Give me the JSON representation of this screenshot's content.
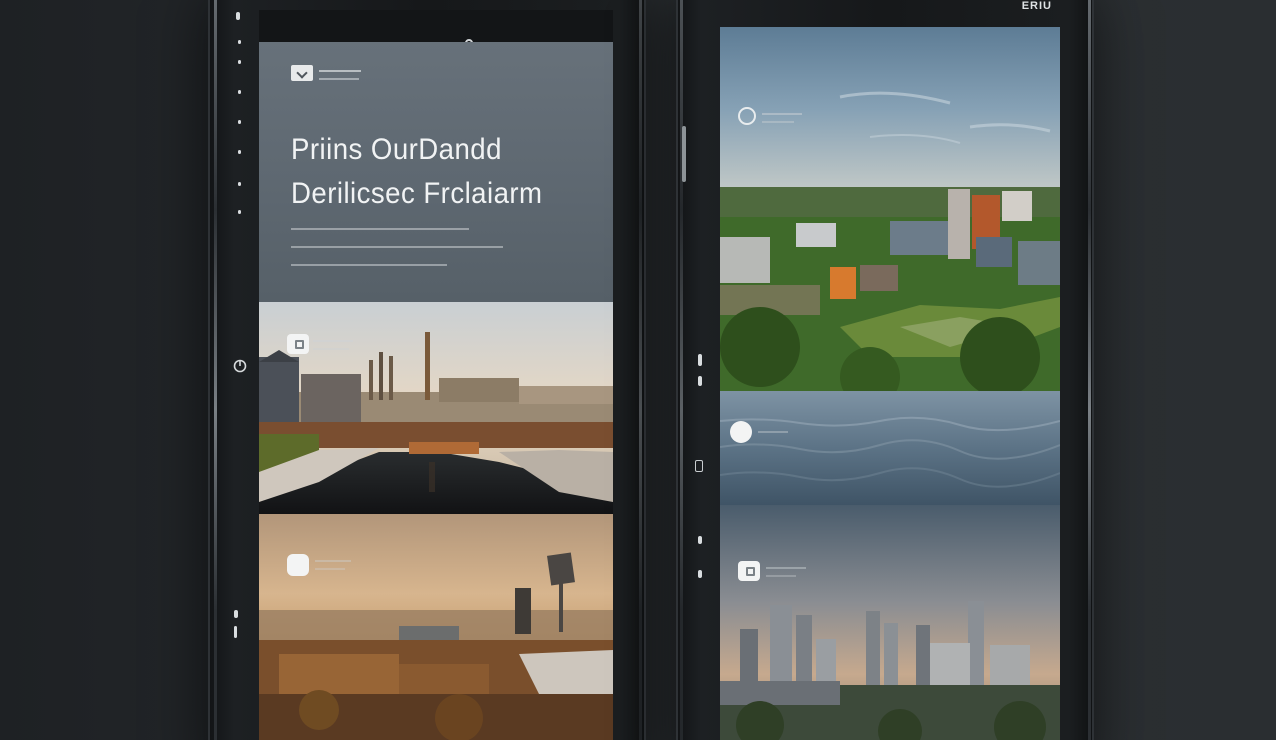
{
  "left_device": {
    "hero": {
      "title_line1": "Priins OurDandd",
      "title_line2": "Derilicsec Frclaiarm"
    }
  },
  "right_device": {
    "brand": "ERIU"
  },
  "colors": {
    "background": "#26292c",
    "hero_panel": "#5f6a73",
    "badge": "#f3f4f4",
    "text": "#f1f3f4"
  },
  "icons": [
    "camera-icon",
    "power-icon",
    "logo-icon",
    "image-badge-icon",
    "circle-badge-icon"
  ]
}
